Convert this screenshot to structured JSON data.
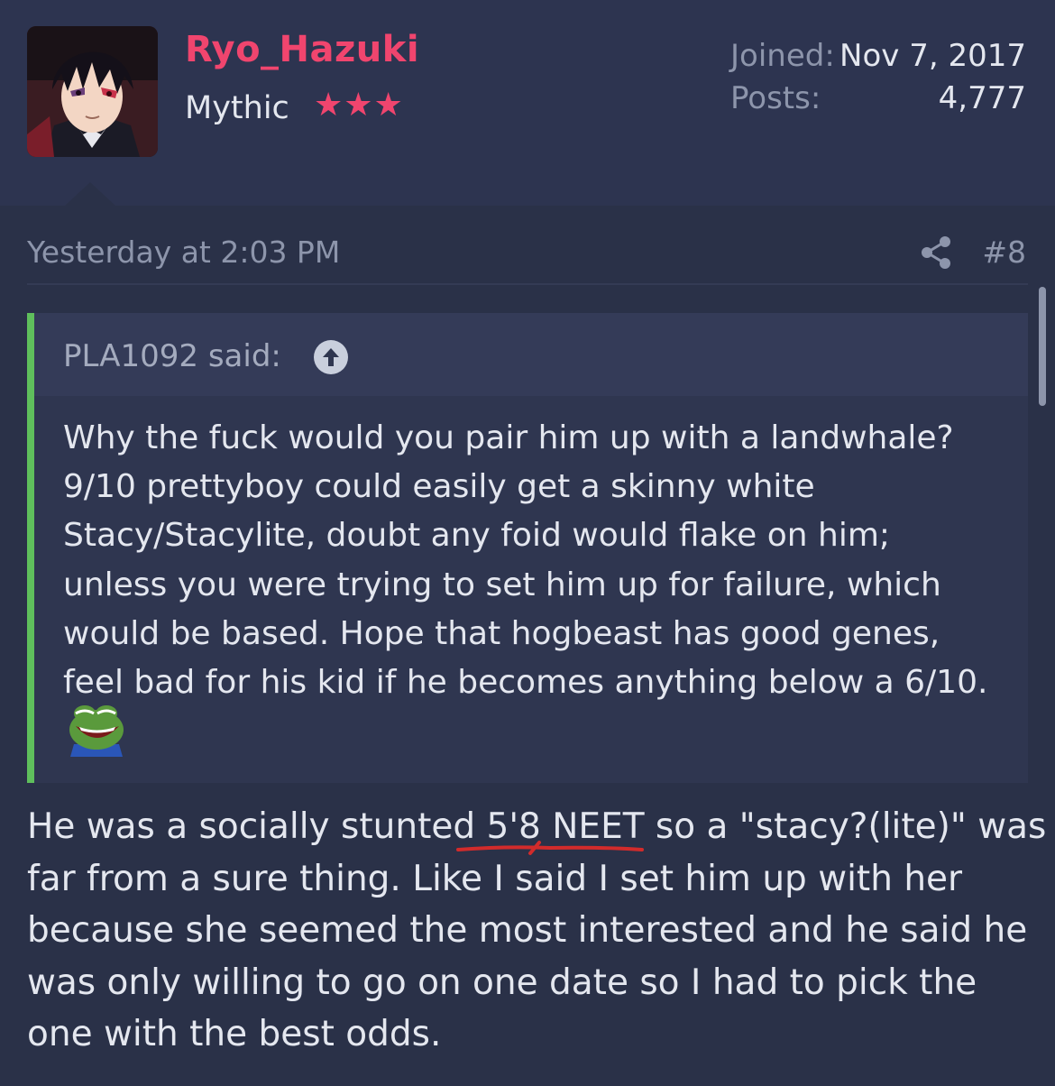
{
  "user": {
    "username": "Ryo_Hazuki",
    "rank": "Mythic",
    "stars": "★★★",
    "joined_label": "Joined:",
    "joined_value": "Nov 7, 2017",
    "posts_label": "Posts:",
    "posts_value": "4,777",
    "avatar_icon": "anime-avatar-icon"
  },
  "post": {
    "timestamp": "Yesterday at 2:03 PM",
    "number": "#8",
    "share_icon": "share-icon"
  },
  "quote": {
    "author": "PLA1092 said:",
    "lines": [
      "Why the fuck would you pair him up with a landwhale?",
      "9/10 prettyboy could easily get a skinny white",
      "Stacy/Stacylite, doubt any foid would flake on him;",
      "unless you were trying to set him up for failure, which",
      "would be based. Hope that hogbeast has good genes,",
      "feel bad for his kid if he becomes anything below a 6/10."
    ],
    "emoji_icon": "laughing-frog-icon"
  },
  "reply": {
    "lines": [
      "He was a socially stunted 5'8 NEET so a \"stacy?(lite)\" was",
      "far from a sure thing. Like I said I set him up with her",
      "because she seemed the most interested and he said he",
      "was only willing to go on one date so I had to pick the",
      "one with the best odds."
    ]
  },
  "colors": {
    "background": "#2a3148",
    "header": "#2d3450",
    "username": "#f0456e",
    "quote_border": "#5fbf5c",
    "annotation": "#d22b2b"
  }
}
